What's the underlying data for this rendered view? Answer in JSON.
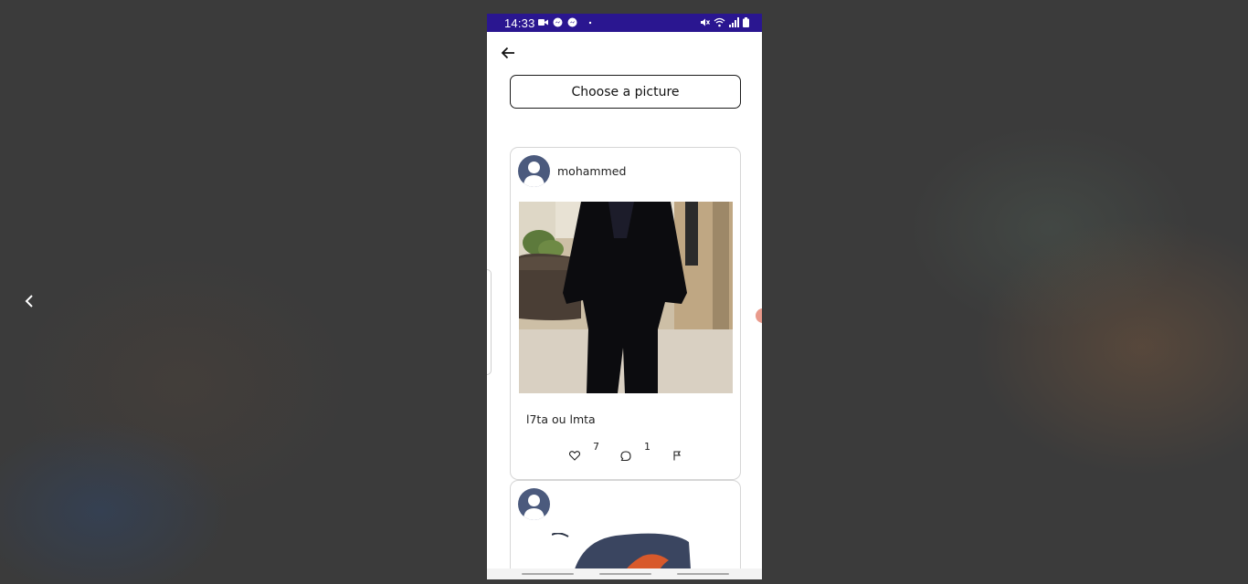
{
  "status_bar": {
    "time": "14:33",
    "background": "#2a1690",
    "left_icons": [
      "video-camera-icon",
      "messenger-icon",
      "messenger-icon",
      "dot-icon"
    ],
    "right_icons": [
      "mute-icon",
      "wifi-icon",
      "signal-icon",
      "battery-icon"
    ]
  },
  "header": {
    "back_icon": "arrow-left-icon"
  },
  "actions_bar": {
    "choose_picture_label": "Choose a picture"
  },
  "feed": {
    "posts": [
      {
        "username": "mohammed",
        "caption": "l7ta ou lmta",
        "likes": "7",
        "comments": "1",
        "icons": [
          "heart-icon",
          "comment-icon",
          "flag-icon"
        ]
      },
      {
        "username": "",
        "caption": ""
      }
    ]
  },
  "viewer": {
    "prev_icon": "chevron-left-icon"
  }
}
